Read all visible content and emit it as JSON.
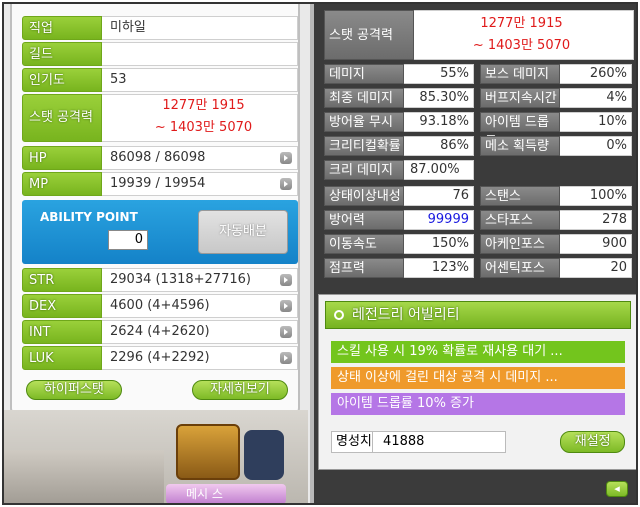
{
  "left": {
    "rows": [
      {
        "label": "직업",
        "value": "미하일"
      },
      {
        "label": "길드",
        "value": ""
      },
      {
        "label": "인기도",
        "value": "53"
      },
      {
        "label": "스탯 공격력",
        "line1": "1277만 1915",
        "line2": "~ 1403만 5070"
      },
      {
        "label": "HP",
        "value": "86098 / 86098"
      },
      {
        "label": "MP",
        "value": "19939 / 19954"
      }
    ],
    "ability_point": {
      "label": "ABILITY POINT",
      "value": "0",
      "auto_button": "자동배분"
    },
    "stats": [
      {
        "label": "STR",
        "value": "29034 (1318+27716)"
      },
      {
        "label": "DEX",
        "value": "4600 (4+4596)"
      },
      {
        "label": "INT",
        "value": "2624 (4+2620)"
      },
      {
        "label": "LUK",
        "value": "2296 (4+2292)"
      }
    ],
    "hyper_button": "하이퍼스탯",
    "detail_button": "자세히보기",
    "partial_name": "메시 스"
  },
  "right": {
    "stat_attack": {
      "label": "스탯 공격력",
      "line1": "1277만 1915",
      "line2": "~ 1403만 5070"
    },
    "rows": [
      {
        "l1": "데미지",
        "v1": "55%",
        "l2": "보스 데미지",
        "v2": "260%"
      },
      {
        "l1": "최종 데미지",
        "v1": "85.30%",
        "l2": "버프지속시간",
        "v2": "4%"
      },
      {
        "l1": "방어율 무시",
        "v1": "93.18%",
        "l2": "아이템 드롭률",
        "v2": "10%"
      },
      {
        "l1": "크리티컬확률",
        "v1": "86%",
        "l2": "메소 획득량",
        "v2": "0%"
      }
    ],
    "crit_damage": {
      "label": "크리 데미지",
      "value": "87.00%"
    },
    "rows2": [
      {
        "l1": "상태이상내성",
        "v1": "76",
        "l2": "스탠스",
        "v2": "100%"
      },
      {
        "l1": "방어력",
        "v1": "99999",
        "l2": "스타포스",
        "v2": "278"
      },
      {
        "l1": "이동속도",
        "v1": "150%",
        "l2": "아케인포스",
        "v2": "900"
      },
      {
        "l1": "점프력",
        "v1": "123%",
        "l2": "어센틱포스",
        "v2": "20"
      }
    ],
    "legend": {
      "title": "레전드리 어빌리티",
      "lines": [
        "스킬 사용 시 19% 확률로 재사용 대기 ...",
        "상태 이상에 걸린 대상 공격 시 데미지 ...",
        "아이템 드롭률 10% 증가"
      ],
      "fame_label": "명성치",
      "fame_value": "41888",
      "reset_button": "재설정"
    },
    "collapse_icon": "◂"
  },
  "colors": {
    "green": "#78b41e",
    "red": "#e01a1a",
    "blue": "#1a1ae0",
    "blue_panel": "#1482c8"
  }
}
